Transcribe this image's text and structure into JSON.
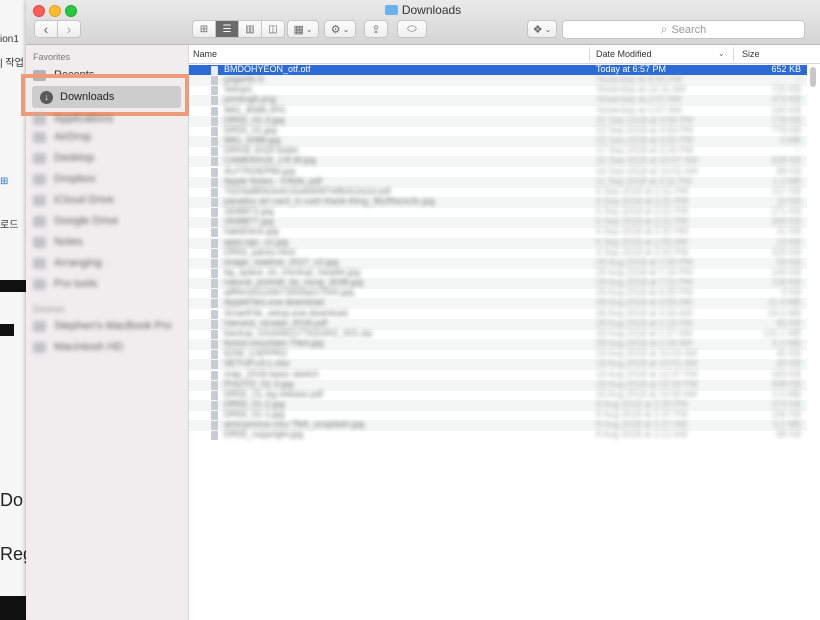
{
  "background_app": {
    "fragments": [
      "ion1",
      "| 작업",
      "로드",
      "Do",
      "Reg"
    ]
  },
  "window": {
    "title": "Downloads",
    "toolbar": {
      "back": "‹",
      "forward": "›",
      "search_placeholder": "Search"
    }
  },
  "sidebar": {
    "favorites_header": "Favorites",
    "partial_item": "Recents",
    "selected_item": "Downloads",
    "blurred_items": [
      "Applications",
      "AirDrop",
      "Desktop",
      "Dropbox",
      "iCloud Drive",
      "Google Drive",
      "Notes",
      "Arranging",
      "Pro tools"
    ],
    "devices_header": "Devices",
    "device_items": [
      "Stephen's MacBook Pro",
      "Macintosh HD"
    ]
  },
  "columns": {
    "name": "Name",
    "date": "Date Modified",
    "size": "Size"
  },
  "files": [
    {
      "name": "BMDOHYEON_otf.otf",
      "date": "Today at 6:57 PM",
      "size": "652 KB",
      "selected": true
    },
    {
      "name": "pagerfix 6",
      "date": "Yesterday at 8:54 PM",
      "size": "--"
    },
    {
      "name": "Setup1",
      "date": "Yesterday at 10:11 AM",
      "size": "720 KB"
    },
    {
      "name": "printing5.png",
      "date": "Yesterday at 2:07 AM",
      "size": "479 KB"
    },
    {
      "name": "IMG_8088.JPG",
      "date": "Yesterday at 1:57 AM",
      "size": "190 KB"
    },
    {
      "name": "DR55_01-3.jpg",
      "date": "22 Sep 2018 at 4:56 PM",
      "size": "778 KB"
    },
    {
      "name": "DR55_01.jpg",
      "date": "22 Sep 2018 at 4:56 PM",
      "size": "778 KB"
    },
    {
      "name": "IMG_0088.jpg",
      "date": "22 Sep 2018 at 4:55 PM",
      "size": "3 MB"
    },
    {
      "name": "DRIVE 2018 folder",
      "date": "17 Sep 2018 at 3:26 PM",
      "size": "--"
    },
    {
      "name": "CAMERA18_J.R.W.jpg",
      "date": "16 Sep 2018 at 10:07 AM",
      "size": "638 KB"
    },
    {
      "name": "ALFTKDEP8d.jpg",
      "date": "16 Sep 2018 at 10:01 AM",
      "size": "88 KB"
    },
    {
      "name": "Apple Notes - FINAL.pdf",
      "date": "11 Sep 2018 at 3:11 PM",
      "size": "1.4 MB"
    },
    {
      "name": "7d1f3a8f0b2e4c16a9d05f7e8b3c2a1d.pdf",
      "date": "6 Sep 2018 at 2:31 PM",
      "size": "157 KB"
    },
    {
      "name": "paradox art card_in rush thank thing_9b2f0a1e3c.jpg",
      "date": "6 Sep 2018 at 2:31 PM",
      "size": "10 KB"
    },
    {
      "name": "1838872.jpg",
      "date": "6 Sep 2018 at 2:21 PM",
      "size": "271 KB"
    },
    {
      "name": "1838877.jpg",
      "date": "6 Sep 2018 at 2:21 PM",
      "size": "265 KB"
    },
    {
      "name": "habitDeck.jpg",
      "date": "6 Sep 2018 at 2:20 PM",
      "size": "21 KB"
    },
    {
      "name": "appLogo_v2.jpg",
      "date": "6 Sep 2018 at 1:55 AM",
      "size": "13 KB"
    },
    {
      "name": "DR55_packs.html",
      "date": "4 Sep 2018 at 2:42 PM",
      "size": "326 KB"
    },
    {
      "name": "image_readme_2017_v2.jpg",
      "date": "29 Aug 2018 at 7:55 PM",
      "size": "59 KB"
    },
    {
      "name": "bg_space_lxi_mockup_header.jpg",
      "date": "29 Aug 2018 at 7:24 PM",
      "size": "149 KB"
    },
    {
      "name": "natural_portrait_by_song_3038.jpg",
      "date": "29 Aug 2018 at 7:21 PM",
      "size": "134 KB"
    },
    {
      "name": "a8f9c0d1116b71833a2c7500.jpg",
      "date": "29 Aug 2018 at 6:49 PM",
      "size": "9 KB"
    },
    {
      "name": "AppleFiles.exe.download",
      "date": "28 Aug 2018 at 3:55 AM",
      "size": "11.4 MB"
    },
    {
      "name": "SmartFile_setup.exe.download",
      "date": "28 Aug 2018 at 3:33 AM",
      "size": "18.4 MB"
    },
    {
      "name": "Harvest_receipt_2018.pdf",
      "date": "28 Aug 2018 at 1:16 PM",
      "size": "85 KB"
    },
    {
      "name": "backup_0316062177631902_001.zip",
      "date": "28 Aug 2018 at 1:27 AM",
      "size": "134.1 MB"
    },
    {
      "name": "forest-mountain-7hk4.jpg",
      "date": "28 Aug 2018 at 1:04 AM",
      "size": "5.4 MB"
    },
    {
      "name": "EDM_CAPPRO",
      "date": "19 Aug 2018 at 10:02 AM",
      "size": "45 KB"
    },
    {
      "name": "SETUP.v3.z.xlsx",
      "date": "19 Aug 2018 at 10:01 AM",
      "size": "20 KB"
    },
    {
      "name": "map_2018 basic sketch",
      "date": "19 Aug 2018 at 12:37 PM",
      "size": "183 KB"
    },
    {
      "name": "PHOTO_01-3.jpg",
      "date": "19 Aug 2018 at 12:34 PM",
      "size": "408 KB"
    },
    {
      "name": "DR55_CL.bg.release.pdf",
      "date": "19 Aug 2018 at 10:40 AM",
      "size": "2.6 MB"
    },
    {
      "name": "DR55_01-2.jpg",
      "date": "8 Aug 2018 at 2:39 PM",
      "size": "374 KB"
    },
    {
      "name": "DR55_01-1.jpg",
      "date": "8 Aug 2018 at 2:37 PM",
      "size": "235 KB"
    },
    {
      "name": "anonymous-chu-7fe6_unsplash.jpg",
      "date": "8 Aug 2018 at 1:17 AM",
      "size": "3.2 MB"
    },
    {
      "name": "DR55_copyright.jpg",
      "date": "8 Aug 2018 at 1:12 AM",
      "size": "88 KB"
    }
  ]
}
